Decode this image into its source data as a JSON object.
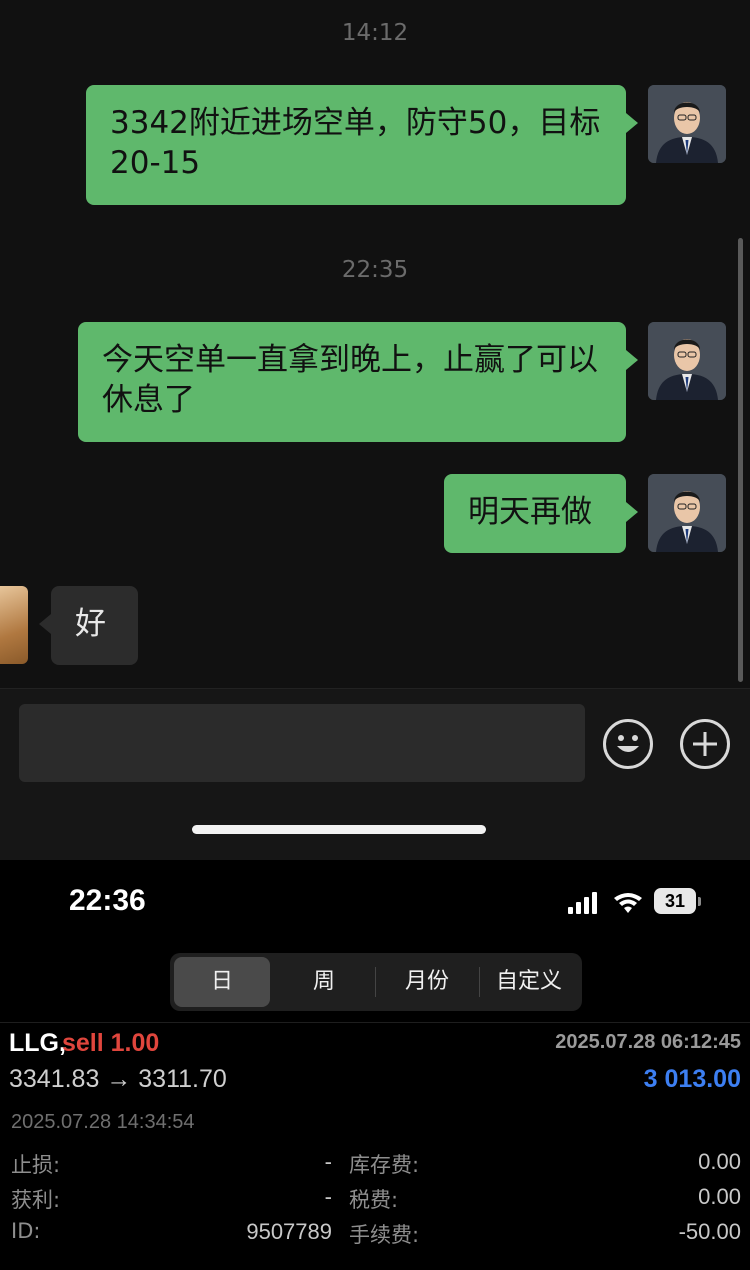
{
  "chat": {
    "timestamps": [
      "14:12",
      "22:35"
    ],
    "messages": [
      {
        "side": "right",
        "text": "3342附近进场空单，防守50，目标20-15"
      },
      {
        "side": "right",
        "text": "今天空单一直拿到晚上，止赢了可以休息了"
      },
      {
        "side": "right",
        "text": "明天再做"
      },
      {
        "side": "left",
        "text": "好"
      }
    ],
    "input_placeholder": "",
    "icons": [
      "emoji-icon",
      "plus-icon"
    ]
  },
  "status_bar": {
    "time": "22:36",
    "battery": "31"
  },
  "period_tabs": [
    {
      "label": "日",
      "active": true
    },
    {
      "label": "周",
      "active": false
    },
    {
      "label": "月份",
      "active": false
    },
    {
      "label": "自定义",
      "active": false
    }
  ],
  "trade": {
    "symbol": "LLG,",
    "side_label": "sell 1.00",
    "open_time": "2025.07.28 06:12:45",
    "price_range": "3341.83 → 3311.70",
    "profit": "3 013.00",
    "close_time": "2025.07.28 14:34:54",
    "fields_left": [
      {
        "label": "止损:",
        "value": "-"
      },
      {
        "label": "获利:",
        "value": "-"
      },
      {
        "label": "ID:",
        "value": "9507789"
      }
    ],
    "fields_right": [
      {
        "label": "库存费:",
        "value": "0.00"
      },
      {
        "label": "税费:",
        "value": "0.00"
      },
      {
        "label": "手续费:",
        "value": "-50.00"
      }
    ],
    "colors": {
      "sell": "#e0463d",
      "profit": "#3d7ff2",
      "bubble_green": "#5fb86c"
    }
  }
}
